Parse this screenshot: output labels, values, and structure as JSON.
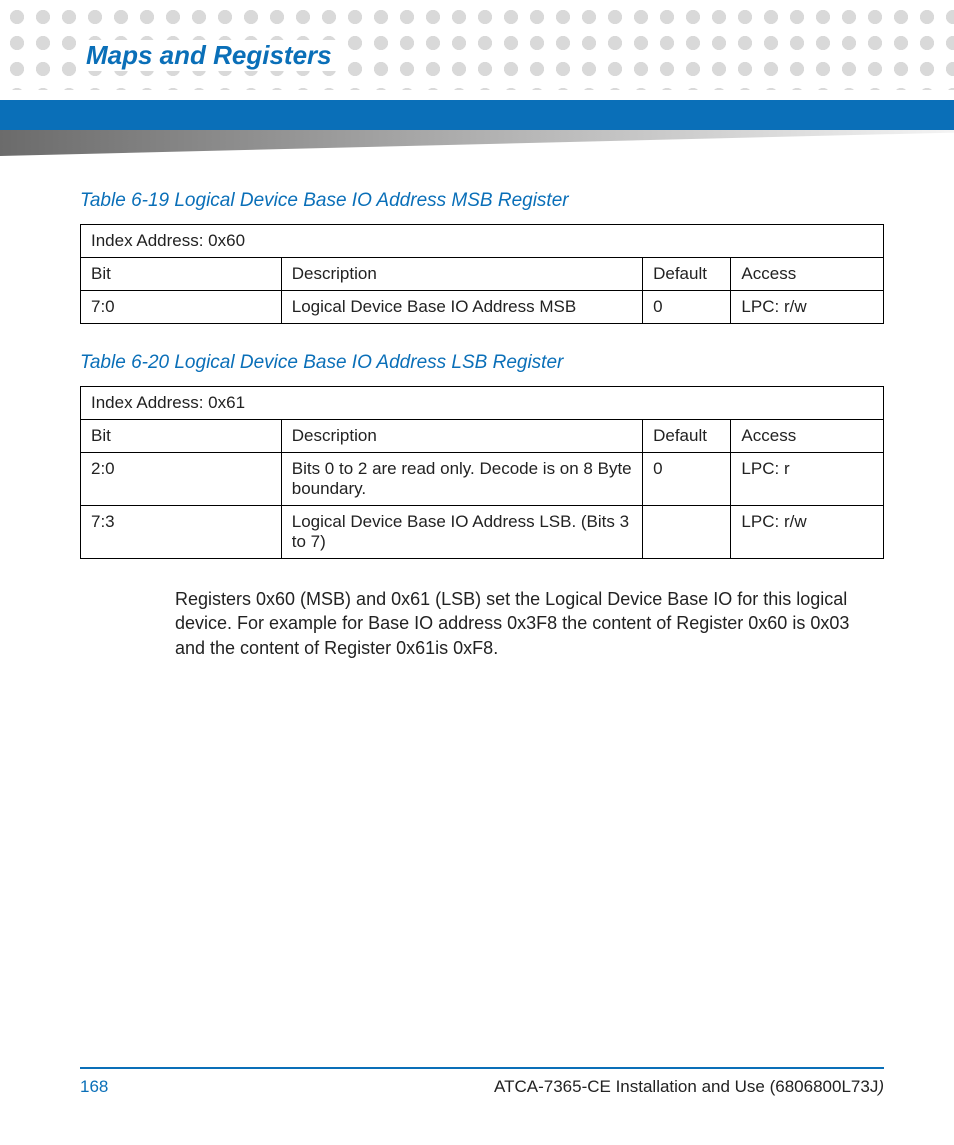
{
  "header": {
    "section_title": "Maps and Registers"
  },
  "tables": [
    {
      "caption": "Table 6-19 Logical Device Base IO Address MSB Register",
      "index_row": "Index Address: 0x60",
      "headers": {
        "bit": "Bit",
        "desc": "Description",
        "def": "Default",
        "acc": "Access"
      },
      "rows": [
        {
          "bit": "7:0",
          "desc": "Logical Device Base IO Address MSB",
          "def": "0",
          "acc": "LPC: r/w"
        }
      ]
    },
    {
      "caption": "Table 6-20 Logical Device Base IO Address LSB Register",
      "index_row": "Index Address: 0x61",
      "headers": {
        "bit": "Bit",
        "desc": "Description",
        "def": "Default",
        "acc": "Access"
      },
      "rows": [
        {
          "bit": "2:0",
          "desc": "Bits 0 to 2 are read only. Decode is on 8 Byte boundary.",
          "def": "0",
          "acc": "LPC: r"
        },
        {
          "bit": "7:3",
          "desc": "Logical Device Base IO Address LSB. (Bits 3 to 7)",
          "def": "",
          "acc": "LPC: r/w"
        }
      ]
    }
  ],
  "body_paragraph": "Registers 0x60 (MSB) and 0x61 (LSB) set the Logical Device Base IO for this logical device. For example for Base IO address 0x3F8 the content of Register 0x60 is 0x03 and the content of Register 0x61is 0xF8.",
  "footer": {
    "page_number": "168",
    "doc_title": "ATCA-7365-CE Installation and Use (6806800L73J",
    "doc_title_trailing": ")"
  }
}
